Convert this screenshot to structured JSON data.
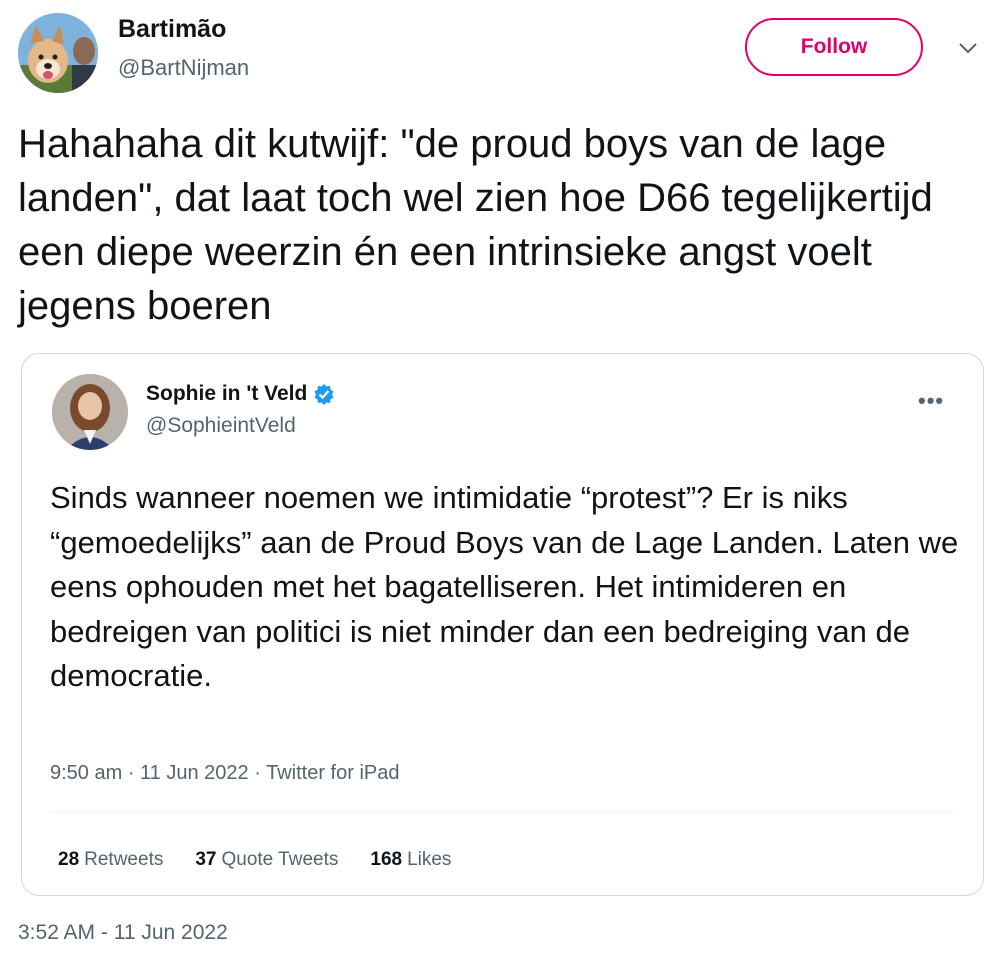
{
  "author": {
    "display_name": "Bartimão",
    "handle": "@BartNijman",
    "avatar_icon": "dog-avatar"
  },
  "follow_label": "Follow",
  "tweet_text": "Hahahaha dit kutwijf: \"de proud boys van de lage landen\", dat laat toch wel zien hoe D66 tegelijkertijd een diepe weerzin én een intrinsieke angst voelt jegens boeren",
  "quoted": {
    "display_name": "Sophie in 't Veld",
    "handle": "@SophieintVeld",
    "verified_icon": "verified-badge-icon",
    "text": "Sinds wanneer noemen we intimidatie “protest”? Er is niks “gemoedelijks” aan de Proud Boys van de Lage Landen. Laten we eens ophouden met het bagatelliseren. Het intimideren en bedreigen van politici is niet minder dan een bedreiging van de democratie.",
    "time": "9:50 am",
    "date": "11 Jun 2022",
    "source": "Twitter for iPad",
    "stats": {
      "retweets_count": "28",
      "retweets_label": "Retweets",
      "quotes_count": "37",
      "quotes_label": "Quote Tweets",
      "likes_count": "168",
      "likes_label": "Likes"
    }
  },
  "timestamp": "3:52 AM - 11 Jun 2022",
  "colors": {
    "follow_accent": "#e0006b",
    "verified": "#1d9bf0",
    "secondary_text": "#536471"
  }
}
